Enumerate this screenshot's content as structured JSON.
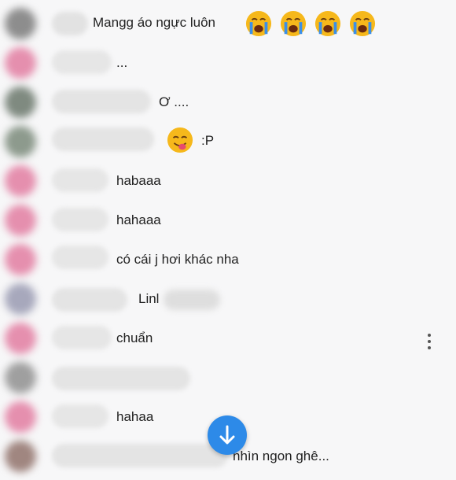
{
  "comments": [
    {
      "text": "Mangg áo ngực luôn",
      "emoji": [
        "crying-face",
        "crying-face",
        "crying-face",
        "crying-face"
      ]
    },
    {
      "text": "..."
    },
    {
      "text": "Ơ ...."
    },
    {
      "text": ":P",
      "emoji": [
        "tongue-face"
      ]
    },
    {
      "text": "habaaa"
    },
    {
      "text": "hahaaa"
    },
    {
      "text": "có cái j hơi khác nha"
    },
    {
      "text": "Linl"
    },
    {
      "text": "chuẩn"
    },
    {
      "text": ""
    },
    {
      "text": "hahaa"
    },
    {
      "text": "nhìn ngon ghê..."
    }
  ],
  "colors": {
    "accent": "#2d8ae8",
    "emoji_yellow": "#f6b81b"
  },
  "icons": {
    "more": "more-vertical-icon",
    "scroll_down": "arrow-down-icon"
  }
}
